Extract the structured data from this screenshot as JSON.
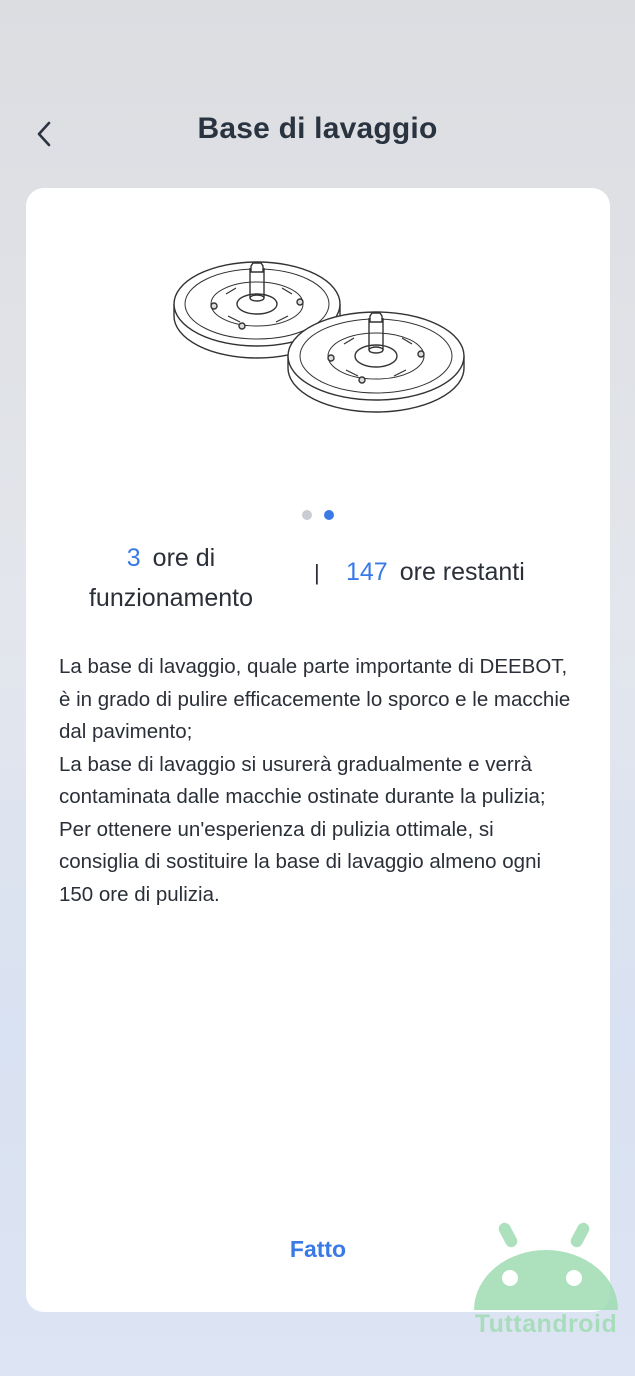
{
  "header": {
    "title": "Base di lavaggio",
    "back_icon": "chevron-left-icon"
  },
  "illustration": {
    "icon": "mop-pads-illustration"
  },
  "carousel": {
    "total": 2,
    "active_index": 1
  },
  "stats": {
    "used_value": "3",
    "used_label": "ore di funzionamento",
    "separator": "|",
    "remaining_value": "147",
    "remaining_label": "ore restanti"
  },
  "description": [
    "La base di lavaggio, quale parte importante di DEEBOT, è in grado di pulire efficacemente lo sporco e le macchie dal pavimento;",
    "La base di lavaggio si usurerà gradualmente e verrà contaminata dalle macchie ostinate durante la pulizia;",
    "Per ottenere un'esperienza di pulizia ottimale, si consiglia di sostituire la base di lavaggio almeno ogni 150 ore di pulizia."
  ],
  "footer": {
    "done_label": "Fatto"
  },
  "watermark": {
    "text": "Tuttandroid"
  },
  "colors": {
    "accent": "#3a7ae6",
    "text": "#2a2f38",
    "watermark": "#9fdcb2"
  }
}
